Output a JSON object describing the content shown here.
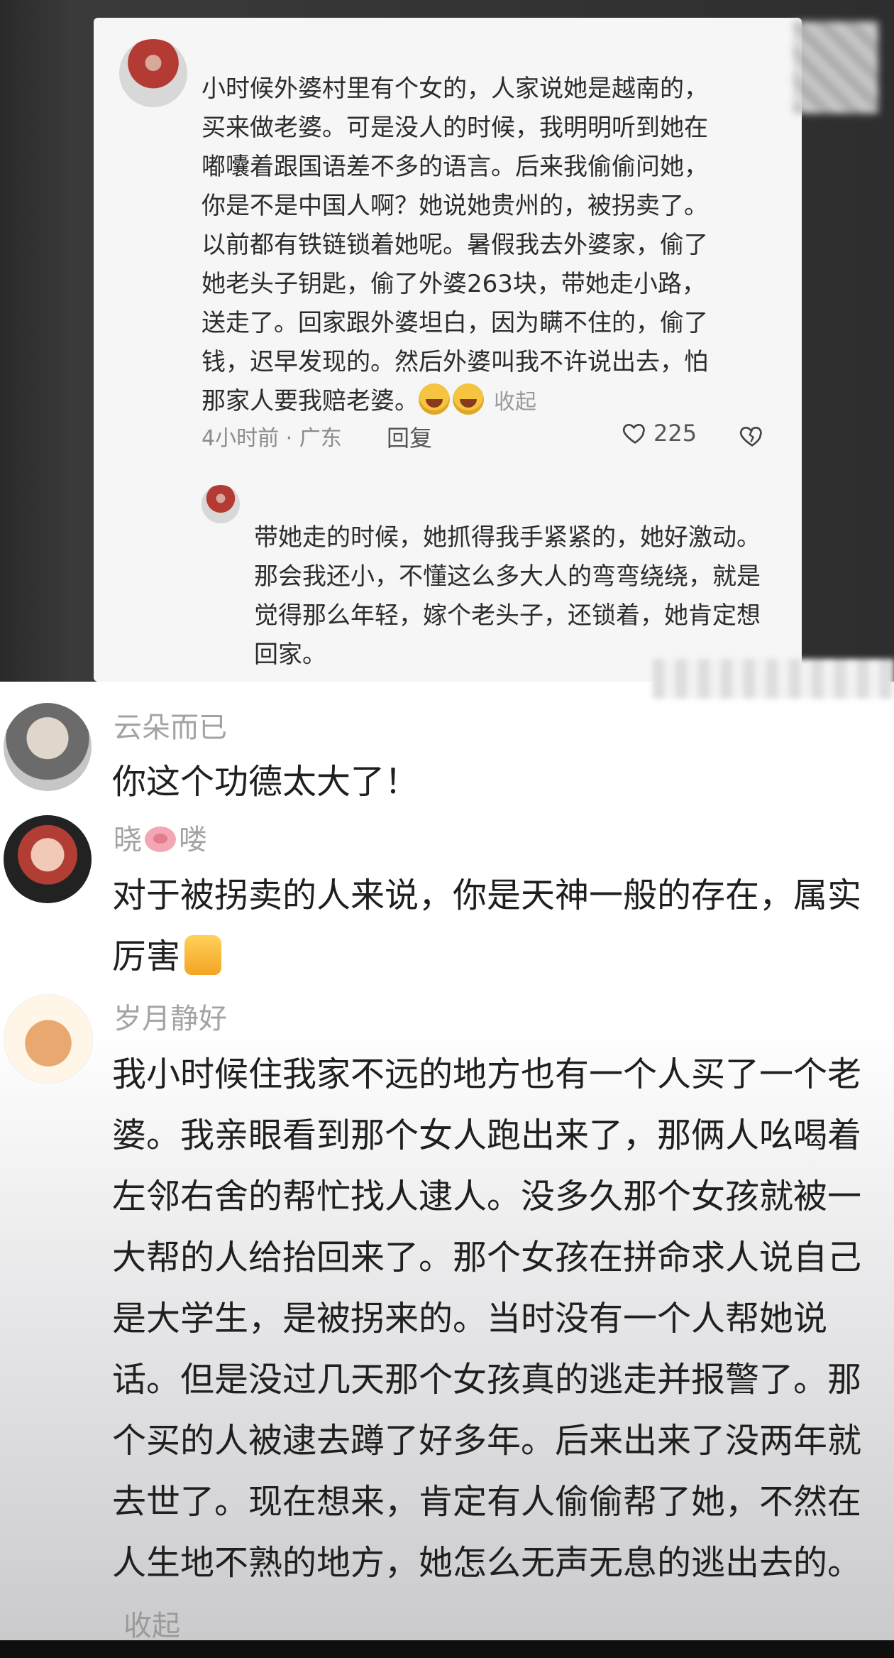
{
  "screenshot_card": {
    "main_comment_lines": "小时候外婆村里有个女的，人家说她是越南的，\n买来做老婆。可是没人的时候，我明明听到她在\n嘟囔着跟国语差不多的语言。后来我偷偷问她，\n你是不是中国人啊？她说她贵州的，被拐卖了。\n以前都有铁链锁着她呢。暑假我去外婆家，偷了\n她老头子钥匙，偷了外婆263块，带她走小路，\n送走了。回家跟外婆坦白，因为瞒不住的，偷了\n钱，迟早发现的。然后外婆叫我不许说出去，怕\n那家人要我赔老婆。",
    "collapse_label": "收起",
    "time_location": "4小时前 · 广东",
    "reply_label": "回复",
    "like_count": "225",
    "reply_text": "带她走的时候，她抓得我手紧紧的，她好激动。那会我还小，不懂这么多大人的弯弯绕绕，就是觉得那么年轻，嫁个老头子，还锁着，她肯定想回家。"
  },
  "comments": [
    {
      "username": "云朵而已",
      "text": "你这个功德太大了！"
    },
    {
      "username_left": "晓",
      "username_right": "喽",
      "text": "对于被拐卖的人来说，你是天神一般的存在，属实厉害"
    },
    {
      "username": "岁月静好",
      "text": "我小时候住我家不远的地方也有一个人买了一个老婆。我亲眼看到那个女人跑出来了，那俩人吆喝着左邻右舍的帮忙找人逮人。没多久那个女孩就被一大帮的人给抬回来了。那个女孩在拼命求人说自己是大学生，是被拐来的。当时没有一个人帮她说话。但是没过几天那个女孩真的逃走并报警了。那个买的人被逮去蹲了好多年。后来出来了没两年就去世了。现在想来，肯定有人偷偷帮了她，不然在人生地不熟的地方，她怎么无声无息的逃出去的。",
      "collapse_label": "收起"
    }
  ],
  "icons": {
    "laugh_cry": "laugh-cry-emoji",
    "heart": "heart-outline",
    "dislike": "broken-heart-outline",
    "pig": "pig-emoji",
    "thumbs_up": "thumbs-up-emoji"
  },
  "colors": {
    "card_bg": "#f6f6f6",
    "meta_gray": "#8b8b8b",
    "username_gray": "#a3a3a3",
    "text_dark": "#1f1f1f"
  }
}
